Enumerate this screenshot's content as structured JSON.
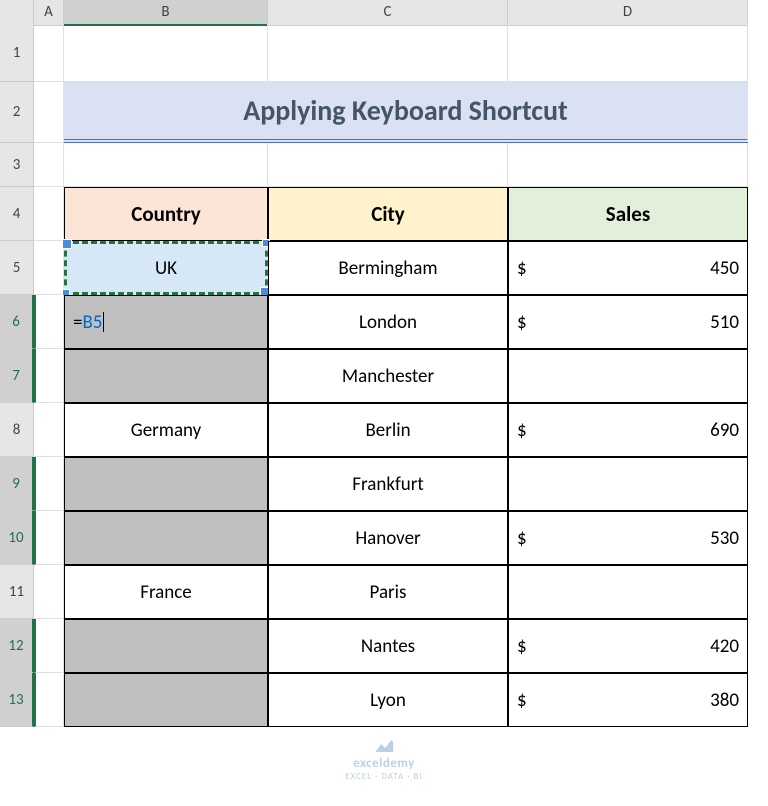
{
  "columns": {
    "a": "A",
    "b": "B",
    "c": "C",
    "d": "D"
  },
  "rows": {
    "r1": "1",
    "r2": "2",
    "r3": "3",
    "r4": "4",
    "r5": "5",
    "r6": "6",
    "r7": "7",
    "r8": "8",
    "r9": "9",
    "r10": "10",
    "r11": "11",
    "r12": "12",
    "r13": "13"
  },
  "title": "Applying Keyboard Shortcut",
  "headers": {
    "country": "Country",
    "city": "City",
    "sales": "Sales"
  },
  "formula": {
    "prefix": "=",
    "ref": "B5"
  },
  "currency": "$",
  "data": {
    "r5": {
      "country": "UK",
      "city": "Bermingham",
      "sales": "450"
    },
    "r6": {
      "country": "",
      "city": "London",
      "sales": "510"
    },
    "r7": {
      "country": "",
      "city": "Manchester",
      "sales": ""
    },
    "r8": {
      "country": "Germany",
      "city": "Berlin",
      "sales": "690"
    },
    "r9": {
      "country": "",
      "city": "Frankfurt",
      "sales": ""
    },
    "r10": {
      "country": "",
      "city": "Hanover",
      "sales": "530"
    },
    "r11": {
      "country": "France",
      "city": "Paris",
      "sales": ""
    },
    "r12": {
      "country": "",
      "city": "Nantes",
      "sales": "420"
    },
    "r13": {
      "country": "",
      "city": "Lyon",
      "sales": "380"
    }
  },
  "watermark": {
    "brand": "exceldemy",
    "tagline": "EXCEL · DATA · BI"
  }
}
